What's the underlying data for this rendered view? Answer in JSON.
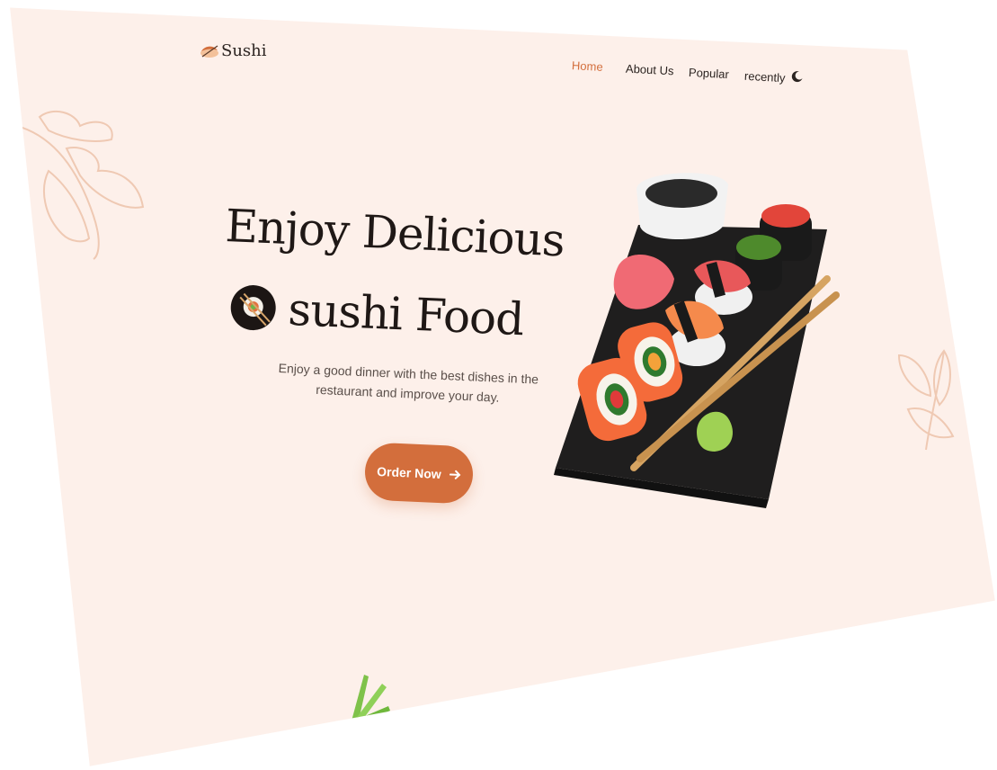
{
  "brand": {
    "name": "Sushi",
    "logo_icon": "sushi-logo-icon"
  },
  "nav": {
    "items": [
      {
        "label": "Home",
        "active": true
      },
      {
        "label": "About Us",
        "active": false
      },
      {
        "label": "Popular",
        "active": false
      },
      {
        "label": "recently",
        "active": false
      }
    ],
    "theme_toggle_icon": "moon-icon"
  },
  "hero": {
    "title_line1": "Enjoy Delicious",
    "title_line2": "sushi Food",
    "description": "Enjoy a good dinner with the best dishes in the restaurant and improve your day.",
    "cta_label": "Order Now",
    "cta_icon": "arrow-right-icon",
    "image": "sushi-board-image"
  },
  "colors": {
    "accent": "#d36e3c",
    "background": "#fdf0ea",
    "text_dark": "#1f1816",
    "text_muted": "#5a4f4a"
  }
}
